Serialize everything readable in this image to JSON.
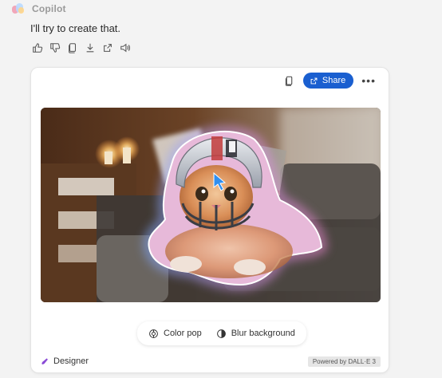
{
  "header": {
    "brand": "Copilot",
    "logo_icon": "copilot-logo"
  },
  "message": {
    "text": "I'll try to create that."
  },
  "message_actions": [
    {
      "name": "thumbs-up-icon"
    },
    {
      "name": "thumbs-down-icon"
    },
    {
      "name": "copy-icon"
    },
    {
      "name": "download-icon"
    },
    {
      "name": "export-icon"
    },
    {
      "name": "speaker-icon"
    }
  ],
  "card": {
    "copy_icon": "copy-icon",
    "share_label": "Share",
    "more_icon": "more-icon",
    "chips": [
      {
        "label": "Color pop",
        "icon": "color-pop-icon"
      },
      {
        "label": "Blur background",
        "icon": "blur-icon"
      }
    ],
    "designer_label": "Designer",
    "powered_label": "Powered by DALL·E 3"
  },
  "colors": {
    "accent": "#1a5fd0",
    "glow_pink": "#f38ad8",
    "glow_blue": "#7fa8ff"
  }
}
